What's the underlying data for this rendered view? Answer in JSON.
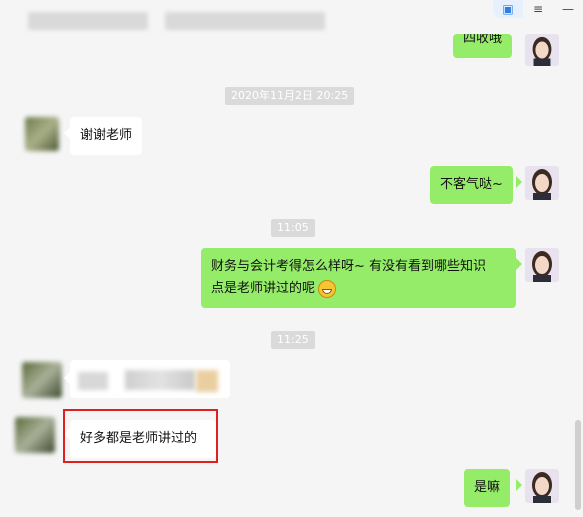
{
  "window_controls": {
    "chat_icon": "chat-icon",
    "menu_icon": "menu-icon",
    "minimize_icon": "minimize-icon"
  },
  "colors": {
    "my_bubble": "#95ec69",
    "their_bubble": "#ffffff",
    "background": "#f5f5f5",
    "highlight_box": "#e02020"
  },
  "messages": {
    "m0_text": "四收哦",
    "m1_time": "2020年11月2日 20:25",
    "m2_text": "谢谢老师",
    "m3_text": "不客气哒~",
    "m4_time": "11:05",
    "m5_text_line1": "财务与会计考得怎么样呀~ 有没有看到哪些知识",
    "m5_text_line2": "点是老师讲过的呢",
    "m6_time": "11:25",
    "m8_text": "好多都是老师讲过的",
    "m9_text": "是嘛"
  }
}
